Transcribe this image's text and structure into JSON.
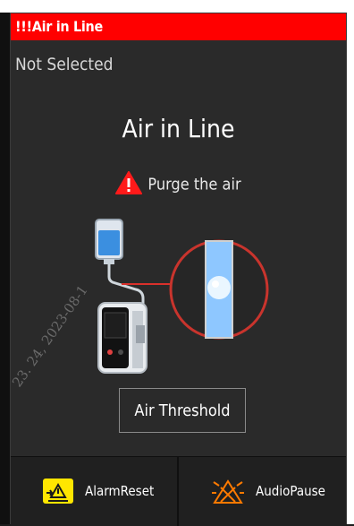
{
  "alarm": {
    "header": "!!!Air in Line",
    "status": "Not Selected",
    "title": "Air in Line",
    "instruction": "Purge the air"
  },
  "controls": {
    "threshold_button": "Air Threshold"
  },
  "footer": {
    "alarm_reset": "AlarmReset",
    "audio_pause": "AudioPause"
  },
  "watermark": "23. 24, 2023-08-1",
  "colors": {
    "alarm_red": "#ff0000",
    "panel_bg": "#2a2a2a",
    "reset_icon_bg": "#ffe600",
    "audio_pause_icon": "#ff7a00"
  },
  "icons": [
    "warning-triangle-icon",
    "alarm-reset-icon",
    "audio-pause-icon"
  ]
}
